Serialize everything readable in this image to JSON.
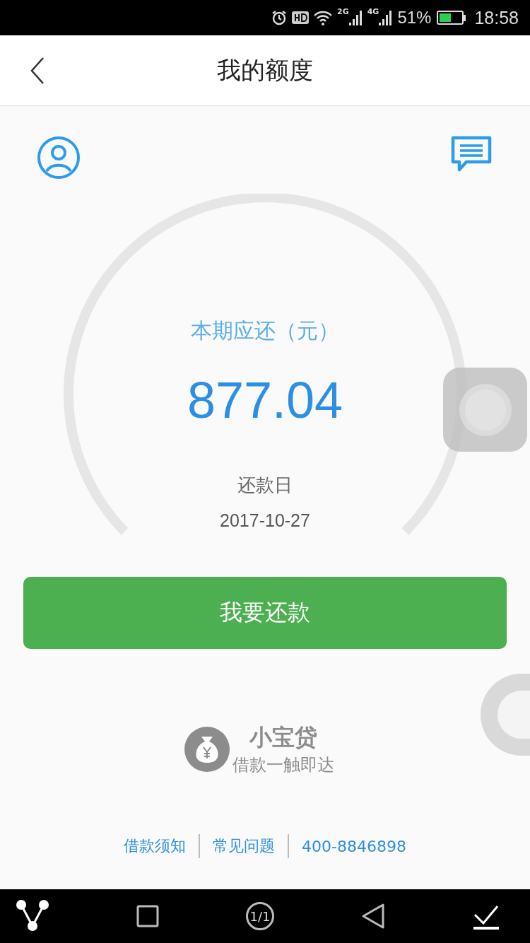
{
  "status_bar": {
    "network_1": "2G",
    "network_2": "4G",
    "battery": "51%",
    "time": "18:58"
  },
  "header": {
    "title": "我的额度"
  },
  "gauge": {
    "label": "本期应还（元）",
    "amount": "877.04",
    "due_label": "还款日",
    "due_date": "2017-10-27"
  },
  "repay_button": "我要还款",
  "brand": {
    "name": "小宝贷",
    "slogan": "借款一触即达"
  },
  "footer_links": [
    "借款须知",
    "常见问题",
    "400-8846898"
  ],
  "nav_bar": {
    "recent_label": "1/1"
  }
}
